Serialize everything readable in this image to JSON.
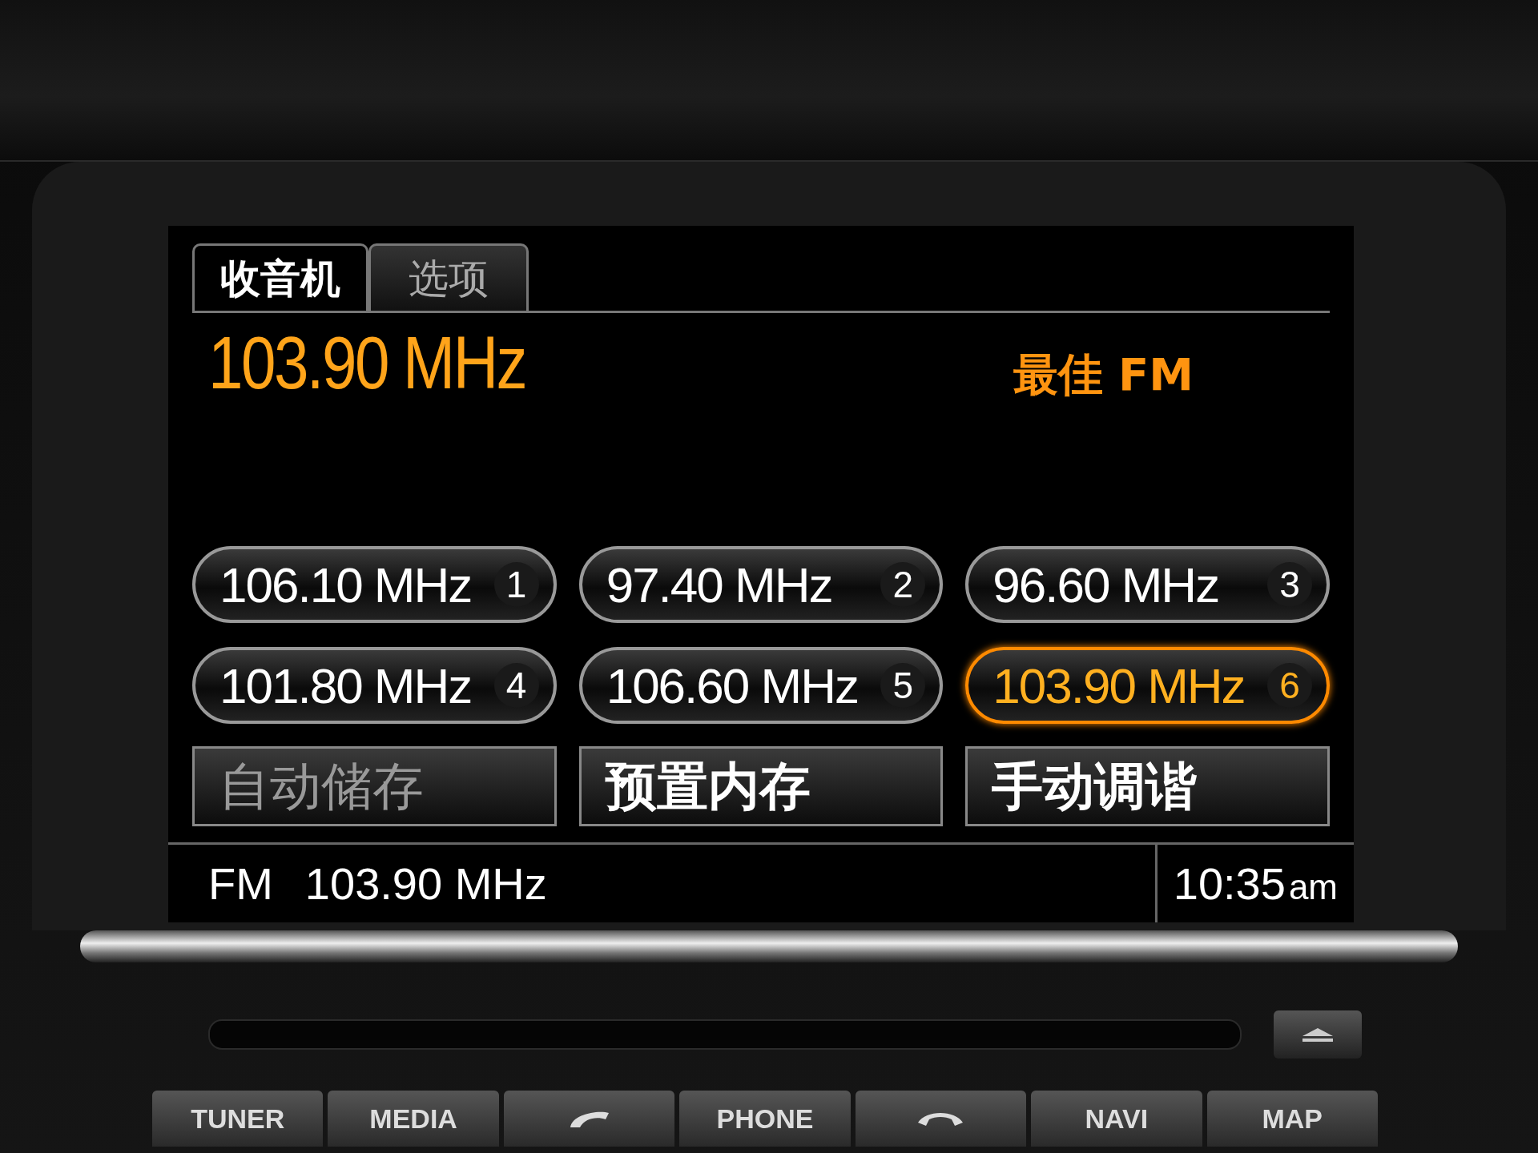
{
  "tabs": [
    {
      "label": "收音机",
      "selected": true
    },
    {
      "label": "选项",
      "selected": false
    }
  ],
  "current_frequency": "103.90 MHz",
  "band_label": "最佳 FM",
  "presets": [
    {
      "frequency": "106.10 MHz",
      "number": "1",
      "selected": false
    },
    {
      "frequency": "97.40 MHz",
      "number": "2",
      "selected": false
    },
    {
      "frequency": "96.60 MHz",
      "number": "3",
      "selected": false
    },
    {
      "frequency": "101.80 MHz",
      "number": "4",
      "selected": false
    },
    {
      "frequency": "106.60 MHz",
      "number": "5",
      "selected": false
    },
    {
      "frequency": "103.90 MHz",
      "number": "6",
      "selected": true
    }
  ],
  "actions": [
    {
      "label": "自动储存",
      "disabled": true
    },
    {
      "label": "预置内存",
      "disabled": false
    },
    {
      "label": "手动调谐",
      "disabled": false
    }
  ],
  "status_bar": {
    "band": "FM",
    "frequency": "103.90 MHz",
    "time": "10:35",
    "meridiem": "am"
  },
  "hardware_buttons": [
    {
      "kind": "text",
      "label": "TUNER"
    },
    {
      "kind": "text",
      "label": "MEDIA"
    },
    {
      "kind": "call"
    },
    {
      "kind": "text",
      "label": "PHONE"
    },
    {
      "kind": "hangup"
    },
    {
      "kind": "text",
      "label": "NAVI"
    },
    {
      "kind": "text",
      "label": "MAP"
    }
  ]
}
